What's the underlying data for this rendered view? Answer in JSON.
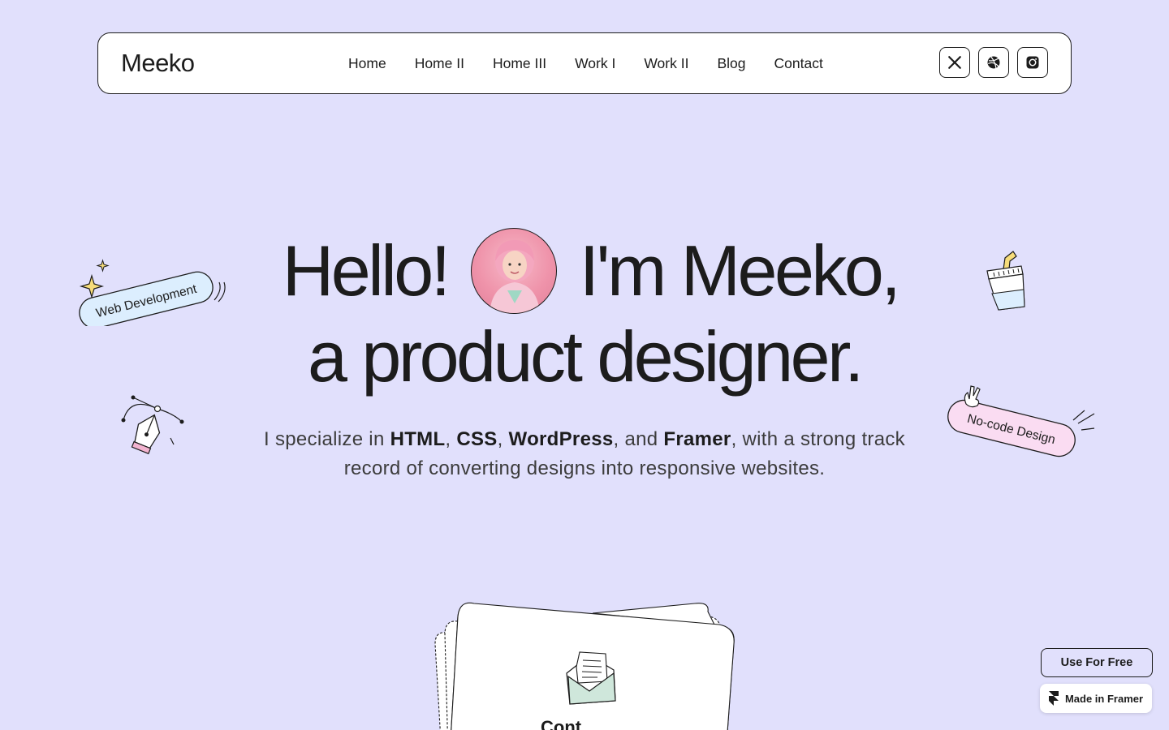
{
  "nav": {
    "logo": "Meeko",
    "links": [
      "Home",
      "Home II",
      "Home III",
      "Work I",
      "Work II",
      "Blog",
      "Contact"
    ],
    "socials": [
      {
        "name": "x-icon"
      },
      {
        "name": "dribbble-icon"
      },
      {
        "name": "instagram-icon"
      }
    ]
  },
  "hero": {
    "hello": "Hello!",
    "im": "I'm Meeko,",
    "line2": "a product designer.",
    "sub_part1": "I specialize in ",
    "sub_html": "HTML",
    "sub_comma1": ", ",
    "sub_css": "CSS",
    "sub_comma2": ", ",
    "sub_wp": "WordPress",
    "sub_and": ",  and ",
    "sub_framer": "Framer",
    "sub_part2": ", with a strong track record of converting designs into responsive websites."
  },
  "stickers": {
    "web_dev": "Web Development",
    "no_code": "No-code Design"
  },
  "contact_card": {
    "label": "Cont"
  },
  "badges": {
    "use_free": "Use For Free",
    "made_in_framer": "Made in Framer"
  },
  "colors": {
    "background": "#e1e0fc",
    "text": "#1c1c1c",
    "web_dev_sticker": "#dceefe",
    "no_code_sticker": "#fadcf2"
  }
}
